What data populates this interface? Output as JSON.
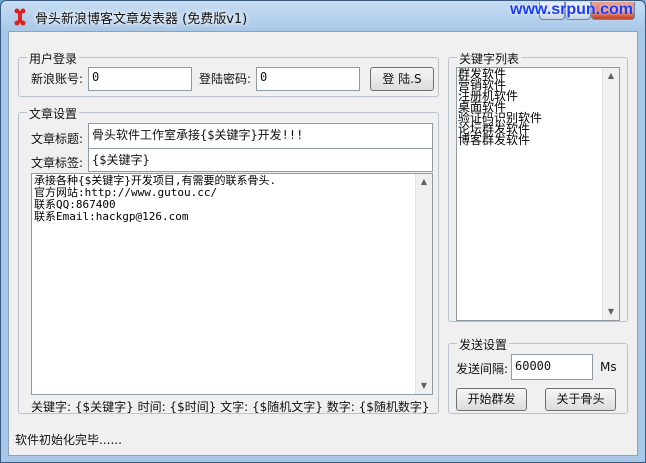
{
  "window": {
    "title": "骨头新浪博客文章发表器 (免费版v1)",
    "watermark": "www.srpun.com"
  },
  "login": {
    "group_title": "用户登录",
    "account_label": "新浪账号:",
    "account_value": "0",
    "password_label": "登陆密码:",
    "password_value": "0",
    "login_button": "登 陆.S"
  },
  "article": {
    "group_title": "文章设置",
    "title_label": "文章标题:",
    "title_value": "骨头软件工作室承接{$关键字}开发!!!",
    "tag_label": "文章标签:",
    "tag_value": "{$关键字}",
    "body_lines": [
      "承接各种{$关键字}开发项目,有需要的联系骨头.",
      "官方网站:http://www.gutou.cc/",
      "联系QQ:867400",
      "联系Email:hackgp@126.com"
    ],
    "variables_hint": "关键字: {$关键字} 时间: {$时间} 文字: {$随机文字} 数字: {$随机数字}"
  },
  "keywords": {
    "group_title": "关键字列表",
    "items": [
      "群发软件",
      "营销软件",
      "注册机软件",
      "桌面软件",
      "验证码识别软件",
      "论坛群发软件",
      "博客群发软件"
    ]
  },
  "send": {
    "group_title": "发送设置",
    "interval_label": "发送间隔:",
    "interval_value": "60000",
    "interval_unit": "Ms",
    "start_button": "开始群发",
    "about_button": "关于骨头"
  },
  "status": {
    "text": "软件初始化完毕......"
  },
  "colors": {
    "title_bg": "#a9c8e8",
    "close_button": "#c6452e",
    "client_bg": "#f0f0f0"
  }
}
